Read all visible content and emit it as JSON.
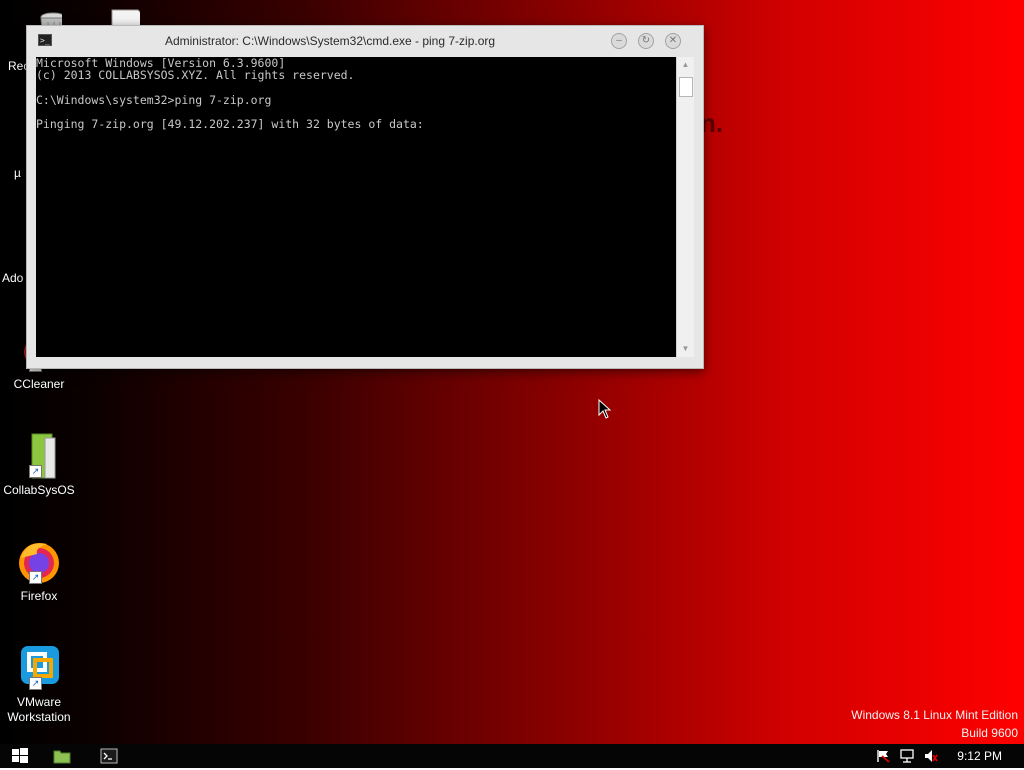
{
  "desktop": {
    "background_fragment": "n.",
    "icons": [
      {
        "label": "Rec",
        "icon": "recycle-bin-icon"
      },
      {
        "label": "",
        "icon": "file-icon"
      },
      {
        "label": "µ",
        "icon": "utorrent-icon"
      },
      {
        "label": "Ado",
        "icon": "adobe-icon"
      },
      {
        "label": "CCleaner",
        "icon": "ccleaner-icon"
      },
      {
        "label": "CollabSysOS",
        "icon": "collabsysos-icon"
      },
      {
        "label": "Firefox",
        "icon": "firefox-icon"
      },
      {
        "label": "VMware Workstation",
        "icon": "vmware-icon"
      }
    ],
    "watermark": {
      "line1": "Windows 8.1 Linux Mint Edition",
      "line2": "Build 9600"
    }
  },
  "cmd_window": {
    "title": "Administrator: C:\\Windows\\System32\\cmd.exe - ping  7-zip.org",
    "console_lines": [
      "Microsoft Windows [Version 6.3.9600]",
      "(c) 2013 COLLABSYSOS.XYZ. All rights reserved.",
      "",
      "C:\\Windows\\system32>ping 7-zip.org",
      "",
      "Pinging 7-zip.org [49.12.202.237] with 32 bytes of data:"
    ]
  },
  "taskbar": {
    "clock": "9:12 PM",
    "buttons": [
      "start-button",
      "file-manager-taskbar-button",
      "cmd-taskbar-button"
    ],
    "tray": [
      "action-center-flag-icon",
      "network-icon",
      "volume-muted-icon"
    ]
  },
  "colors": {
    "desktop_left": "#000000",
    "desktop_right": "#ff0000",
    "console_bg": "#000000",
    "console_text": "#c8c8c8",
    "taskbar_bg": "#050505"
  }
}
